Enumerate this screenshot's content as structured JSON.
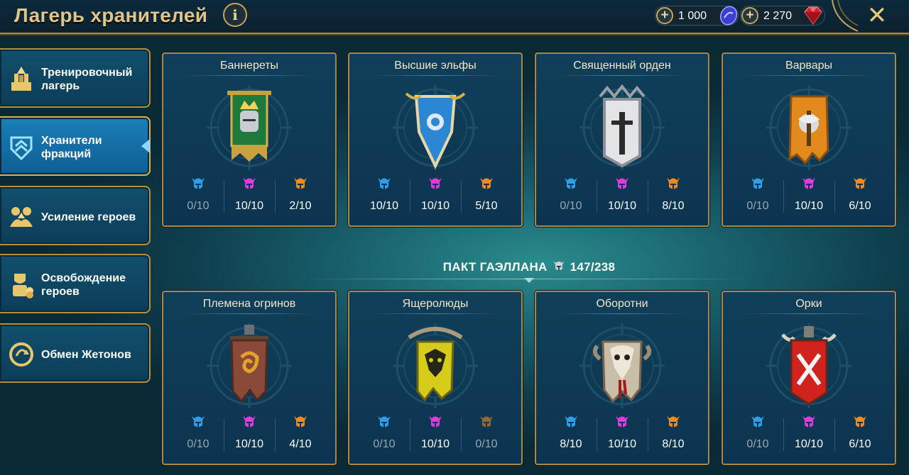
{
  "header": {
    "title": "Лагерь хранителей",
    "info_label": "i",
    "close_label": "✕"
  },
  "resources": [
    {
      "value": "1 000",
      "icon": "blue-shard-icon",
      "color": "#6d6cff"
    },
    {
      "value": "2 270",
      "icon": "gem-icon",
      "color": "#e8202a"
    }
  ],
  "menu": [
    {
      "label": "Тренировочный лагерь",
      "icon": "training-camp-icon",
      "active": false
    },
    {
      "label": "Хранители фракций",
      "icon": "faction-guardians-icon",
      "active": true
    },
    {
      "label": "Усиление героев",
      "icon": "hero-boost-icon",
      "active": false
    },
    {
      "label": "Освобождение героев",
      "icon": "hero-release-icon",
      "active": false
    },
    {
      "label": "Обмен Жетонов",
      "icon": "token-exchange-icon",
      "active": false
    }
  ],
  "slot_colors": {
    "rare": "#2f9ee8",
    "epic": "#e03bd8",
    "legendary": "#f08a1c"
  },
  "factions_row1": [
    {
      "name": "Баннереты",
      "icon": "banneret-banner-icon",
      "rare": "0/10",
      "epic": "10/10",
      "legendary": "2/10"
    },
    {
      "name": "Высшие эльфы",
      "icon": "high-elves-shield-icon",
      "rare": "10/10",
      "epic": "10/10",
      "legendary": "5/10"
    },
    {
      "name": "Священный орден",
      "icon": "sacred-order-shield-icon",
      "rare": "0/10",
      "epic": "10/10",
      "legendary": "8/10"
    },
    {
      "name": "Варвары",
      "icon": "barbarian-banner-icon",
      "rare": "0/10",
      "epic": "10/10",
      "legendary": "6/10"
    }
  ],
  "pact": {
    "label": "ПАКТ ГАЭЛЛАНА",
    "icon": "helmet-icon",
    "value": "147/238"
  },
  "factions_row2": [
    {
      "name": "Племена огринов",
      "icon": "ogryn-banner-icon",
      "rare": "0/10",
      "epic": "10/10",
      "legendary": "4/10"
    },
    {
      "name": "Ящеролюды",
      "icon": "lizardmen-banner-icon",
      "rare": "0/10",
      "epic": "10/10",
      "legendary": "0/10"
    },
    {
      "name": "Оборотни",
      "icon": "skinwalker-banner-icon",
      "rare": "8/10",
      "epic": "10/10",
      "legendary": "8/10"
    },
    {
      "name": "Орки",
      "icon": "orc-banner-icon",
      "rare": "0/10",
      "epic": "10/10",
      "legendary": "6/10"
    }
  ]
}
